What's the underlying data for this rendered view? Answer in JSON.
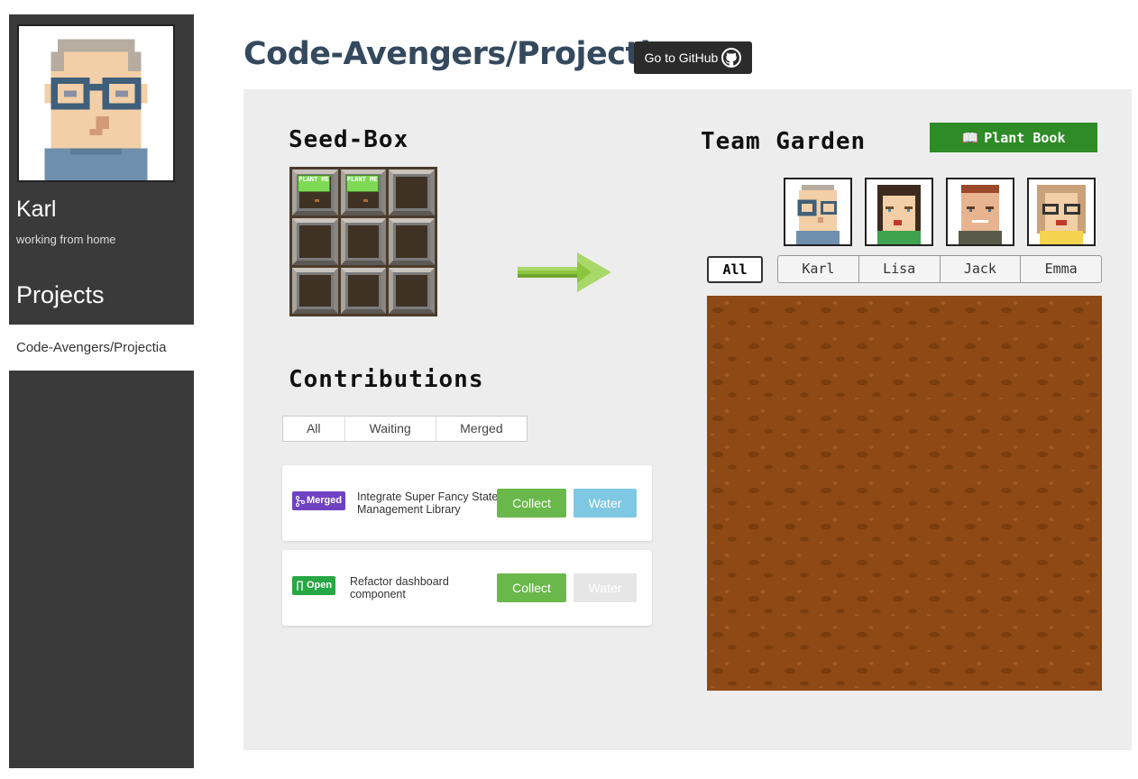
{
  "user": {
    "name": "Karl",
    "status": "working from home"
  },
  "sidebar": {
    "projects_heading": "Projects",
    "projects": [
      "Code-Avengers/Projectia"
    ]
  },
  "header": {
    "title": "Code-Avengers/Projectia",
    "github_button": "Go to GitHub"
  },
  "seedbox": {
    "title": "Seed-Box",
    "plant_label": "PLANT ME"
  },
  "garden": {
    "title": "Team Garden",
    "plant_book_label": "Plant Book",
    "filters": {
      "all": "All",
      "members": [
        "Karl",
        "Lisa",
        "Jack",
        "Emma"
      ]
    }
  },
  "contributions": {
    "title": "Contributions",
    "tabs": [
      "All",
      "Waiting",
      "Merged"
    ],
    "items": [
      {
        "status": "Merged",
        "title": "Integrate Super Fancy State Management Library",
        "collect": "Collect",
        "water": "Water"
      },
      {
        "status": "Open",
        "title": "Refactor dashboard component",
        "collect": "Collect",
        "water": "Water"
      }
    ]
  },
  "colors": {
    "merged": "#6f42c1",
    "open": "#28a745",
    "collect": "#6ab84b",
    "water_active": "#7ec8e3",
    "water_disabled": "#e6e6e6",
    "plant_book": "#2e8b27",
    "soil": "#8e4914"
  }
}
